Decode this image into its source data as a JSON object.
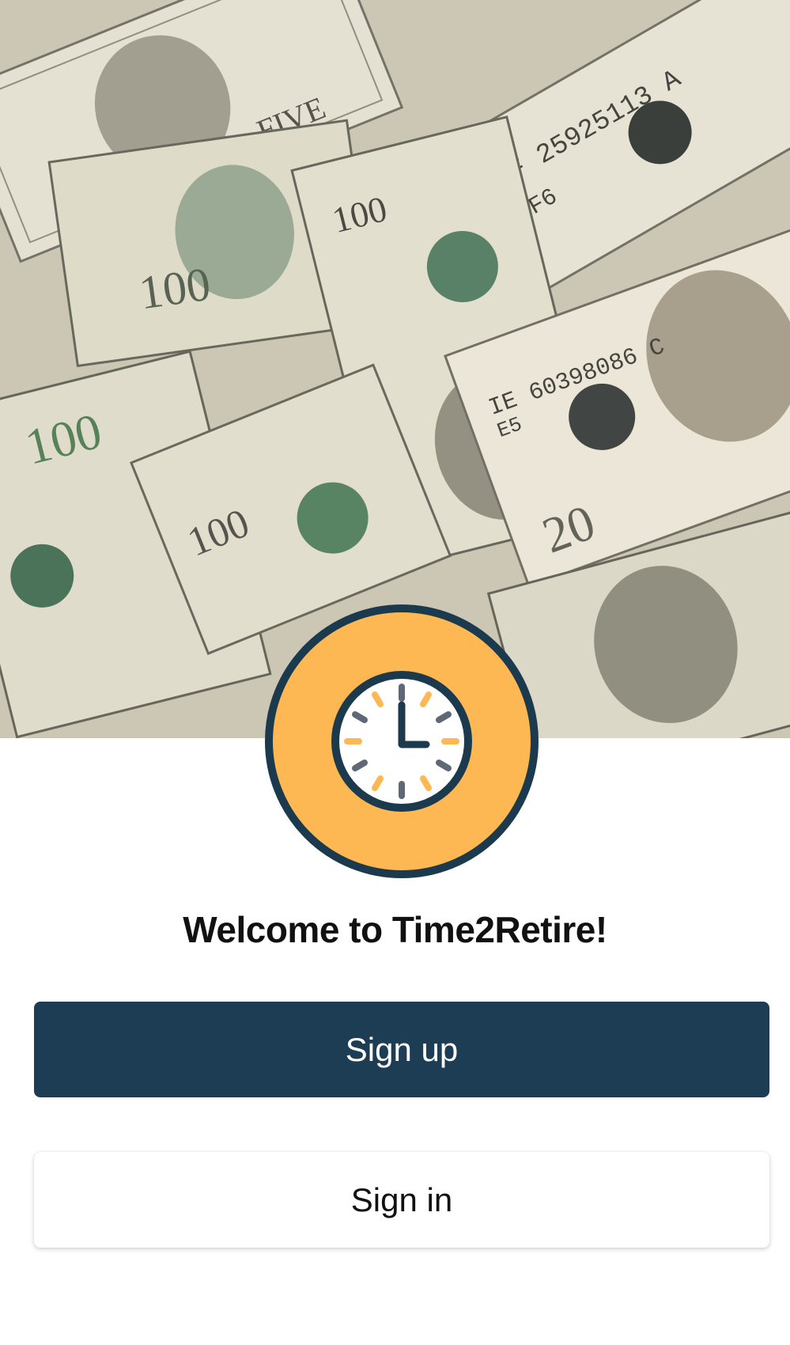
{
  "hero": {
    "image_description_icon": "money-background-image"
  },
  "logo": {
    "icon": "clock-icon",
    "colors": {
      "accent": "#FDB853",
      "ring": "#1B3A4E",
      "face": "#FFFFFF"
    }
  },
  "welcome": {
    "title": "Welcome to Time2Retire!"
  },
  "actions": {
    "signup_label": "Sign up",
    "signin_label": "Sign in"
  },
  "colors": {
    "primary": "#1D3D54",
    "background": "#FFFFFF"
  }
}
